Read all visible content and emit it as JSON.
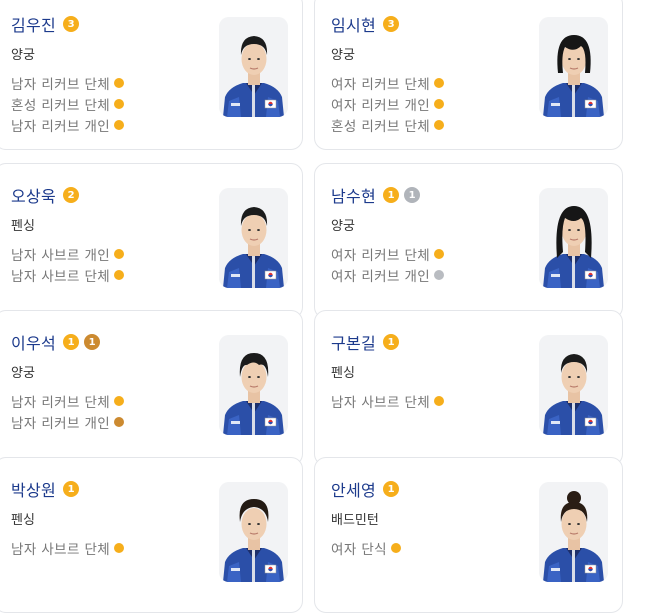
{
  "colors": {
    "gold": "#f6ae1b",
    "silver": "#b0b4ba",
    "bronze": "#cc8a30",
    "name": "#1c3a8c"
  },
  "athletes": [
    {
      "name": "김우진",
      "medals": [
        {
          "type": "gold",
          "count": "3"
        }
      ],
      "sport": "양궁",
      "events": [
        {
          "label": "남자 리커브 단체",
          "medal": "gold"
        },
        {
          "label": "혼성 리커브 단체",
          "medal": "gold"
        },
        {
          "label": "남자 리커브 개인",
          "medal": "gold"
        }
      ],
      "photo": {
        "hair": "short",
        "icon": "athlete-photo"
      }
    },
    {
      "name": "임시현",
      "medals": [
        {
          "type": "gold",
          "count": "3"
        }
      ],
      "sport": "양궁",
      "events": [
        {
          "label": "여자 리커브 단체",
          "medal": "gold"
        },
        {
          "label": "여자 리커브 개인",
          "medal": "gold"
        },
        {
          "label": "혼성 리커브 단체",
          "medal": "gold"
        }
      ],
      "photo": {
        "hair": "bob",
        "icon": "athlete-photo"
      }
    },
    {
      "name": "오상욱",
      "medals": [
        {
          "type": "gold",
          "count": "2"
        }
      ],
      "sport": "펜싱",
      "events": [
        {
          "label": "남자 사브르 개인",
          "medal": "gold"
        },
        {
          "label": "남자 사브르 단체",
          "medal": "gold"
        }
      ],
      "photo": {
        "hair": "short",
        "icon": "athlete-photo"
      }
    },
    {
      "name": "남수현",
      "medals": [
        {
          "type": "gold",
          "count": "1"
        },
        {
          "type": "silver",
          "count": "1"
        }
      ],
      "sport": "양궁",
      "events": [
        {
          "label": "여자 리커브 단체",
          "medal": "gold"
        },
        {
          "label": "여자 리커브 개인",
          "medal": "silver"
        }
      ],
      "photo": {
        "hair": "long",
        "icon": "athlete-photo"
      }
    },
    {
      "name": "이우석",
      "medals": [
        {
          "type": "gold",
          "count": "1"
        },
        {
          "type": "bronze",
          "count": "1"
        }
      ],
      "sport": "양궁",
      "events": [
        {
          "label": "남자 리커브 단체",
          "medal": "gold"
        },
        {
          "label": "남자 리커브 개인",
          "medal": "bronze"
        }
      ],
      "photo": {
        "hair": "medium",
        "icon": "athlete-photo"
      }
    },
    {
      "name": "구본길",
      "medals": [
        {
          "type": "gold",
          "count": "1"
        }
      ],
      "sport": "펜싱",
      "events": [
        {
          "label": "남자 사브르 단체",
          "medal": "gold"
        }
      ],
      "photo": {
        "hair": "short",
        "icon": "athlete-photo"
      }
    },
    {
      "name": "박상원",
      "medals": [
        {
          "type": "gold",
          "count": "1"
        }
      ],
      "sport": "펜싱",
      "events": [
        {
          "label": "남자 사브르 단체",
          "medal": "gold"
        }
      ],
      "photo": {
        "hair": "curly",
        "icon": "athlete-photo"
      }
    },
    {
      "name": "안세영",
      "medals": [
        {
          "type": "gold",
          "count": "1"
        }
      ],
      "sport": "배드민턴",
      "events": [
        {
          "label": "여자 단식",
          "medal": "gold"
        }
      ],
      "photo": {
        "hair": "bun",
        "icon": "athlete-photo"
      }
    }
  ]
}
